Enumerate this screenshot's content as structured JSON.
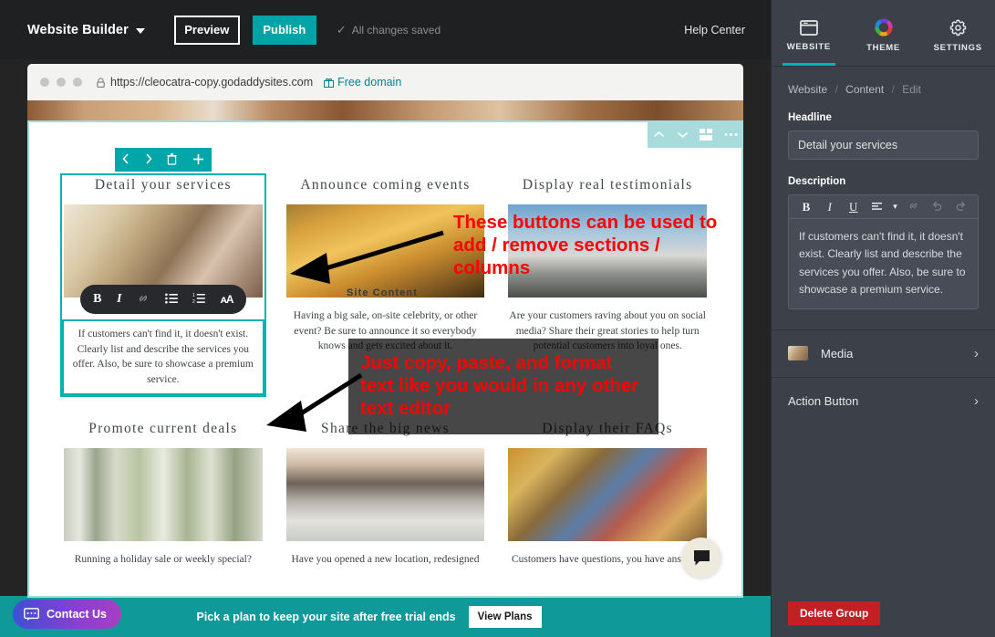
{
  "topbar": {
    "brand": "Website Builder",
    "preview_label": "Preview",
    "publish_label": "Publish",
    "saved_text": "All changes saved",
    "check_glyph": "✓",
    "help_label": "Help Center"
  },
  "browser": {
    "url": "https://cleocatra-copy.godaddysites.com",
    "lock_glyph": "ὑ2",
    "free_domain": "Free domain"
  },
  "site": {
    "content_label": "Site Content",
    "section_toolbar": [
      {
        "name": "move-section-up-icon",
        "glyph": "⌃"
      },
      {
        "name": "move-section-down-icon",
        "glyph": "⌄"
      },
      {
        "name": "section-layout-icon",
        "glyph": "▤"
      },
      {
        "name": "section-more-icon",
        "glyph": "•••"
      }
    ],
    "column_toolbar": [
      {
        "name": "move-column-left-icon",
        "glyph": "‹"
      },
      {
        "name": "move-column-right-icon",
        "glyph": "›"
      },
      {
        "name": "delete-column-icon",
        "glyph": "🗑"
      },
      {
        "name": "add-column-icon",
        "glyph": "+"
      }
    ],
    "format_toolbar": [
      {
        "name": "bold-icon",
        "glyph": "B",
        "dim": false
      },
      {
        "name": "italic-icon",
        "glyph": "I",
        "dim": false
      },
      {
        "name": "link-icon",
        "glyph": "🔗",
        "dim": true
      },
      {
        "name": "bullet-list-icon",
        "glyph": "☰",
        "dim": false
      },
      {
        "name": "numbered-list-icon",
        "glyph": "≡",
        "dim": false
      },
      {
        "name": "font-size-icon",
        "glyph": "ᴀA",
        "dim": false
      }
    ],
    "rows": [
      [
        {
          "title": "Detail your services",
          "image": "img-wedding",
          "text": "If customers can't find it, it doesn't exist. Clearly list and describe the services you offer. Also, be sure to showcase a premium service.",
          "selected": true
        },
        {
          "title": "Announce coming events",
          "image": "img-field",
          "text": "Having a big sale, on-site celebrity, or other event? Be sure to announce it so everybody knows and gets excited about it.",
          "selected": false
        },
        {
          "title": "Display real testimonials",
          "image": "img-sky",
          "text": "Are your customers raving about you on social media? Share their great stories to help turn potential customers into loyal ones.",
          "selected": false
        }
      ],
      [
        {
          "title": "Promote current deals",
          "image": "img-birch",
          "text": "Running a holiday sale or weekly special?",
          "selected": false
        },
        {
          "title": "Share the big news",
          "image": "img-ocean",
          "text": "Have you opened a new location, redesigned",
          "selected": false
        },
        {
          "title": "Display their FAQs",
          "image": "img-family",
          "text": "Customers have questions, you have answers.",
          "selected": false
        }
      ]
    ],
    "chat_glyph": "💬"
  },
  "annotations": {
    "one": "These buttons can be used to add / remove sections / columns",
    "two": "Just copy, paste, and format text like you would in any other text editor"
  },
  "panel": {
    "tabs": [
      {
        "label": "WEBSITE",
        "icon": "website-panel-icon",
        "active": true
      },
      {
        "label": "THEME",
        "icon": "theme-color-wheel-icon",
        "active": false
      },
      {
        "label": "SETTINGS",
        "icon": "gear-icon",
        "active": false
      }
    ],
    "breadcrumb": {
      "root": "Website",
      "mid": "Content",
      "current": "Edit",
      "sep": "/"
    },
    "headline_label": "Headline",
    "headline_value": "Detail your services",
    "description_label": "Description",
    "description_value": "If customers can't find it, it doesn't exist. Clearly list and describe the services you offer. Also, be sure to showcase a premium service.",
    "rte_buttons": [
      {
        "name": "bold-icon",
        "glyph": "B",
        "dim": false
      },
      {
        "name": "italic-icon",
        "glyph": "I",
        "dim": false
      },
      {
        "name": "underline-icon",
        "glyph": "U",
        "dim": false
      },
      {
        "name": "align-icon",
        "glyph": "≡",
        "dim": false
      },
      {
        "name": "align-dropdown-icon",
        "glyph": "▾",
        "dim": false
      },
      {
        "name": "link-icon",
        "glyph": "🔗",
        "dim": true
      },
      {
        "name": "undo-icon",
        "glyph": "↶",
        "dim": true
      },
      {
        "name": "redo-icon",
        "glyph": "↷",
        "dim": true
      }
    ],
    "media_label": "Media",
    "action_button_label": "Action Button",
    "chevron_glyph": "›",
    "delete_label": "Delete Group"
  },
  "bottombar": {
    "contact_label": "Contact Us",
    "contact_glyph": "💬",
    "trial_text": "Pick a plan to keep your site after free trial ends",
    "view_plans_label": "View Plans"
  },
  "colors": {
    "teal": "#00a4a6",
    "light_teal": "#a8dcdc",
    "panel_bg": "#3c4049",
    "topbar_bg": "#1f2021",
    "bottom_bar": "#109999",
    "annotation_red": "#ff0000",
    "delete_red": "#c32026"
  }
}
